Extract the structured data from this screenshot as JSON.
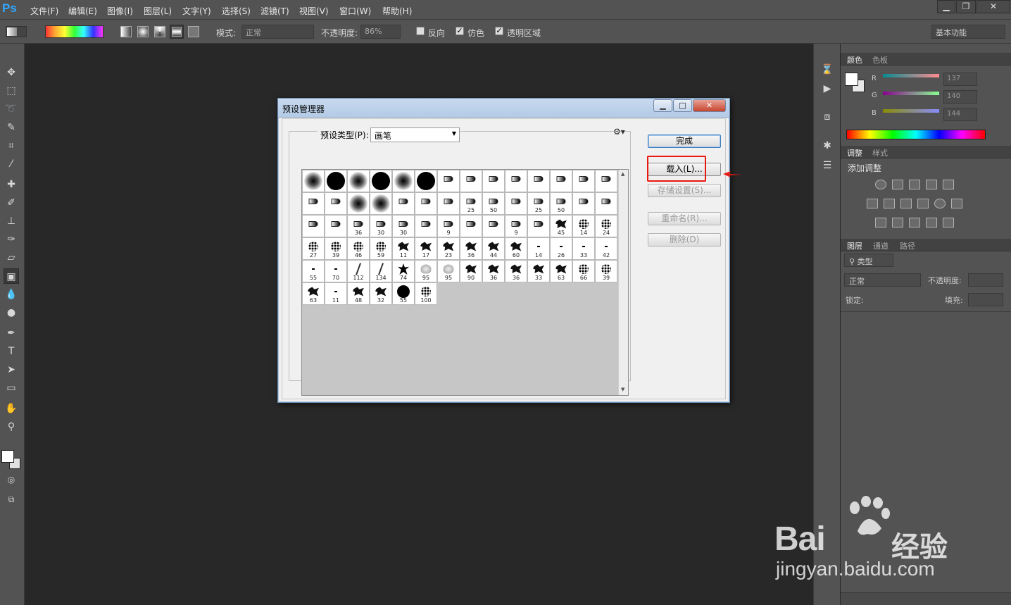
{
  "app": {
    "logo": "Ps"
  },
  "menu": [
    "文件(F)",
    "编辑(E)",
    "图像(I)",
    "图层(L)",
    "文字(Y)",
    "选择(S)",
    "滤镜(T)",
    "视图(V)",
    "窗口(W)",
    "帮助(H)"
  ],
  "window_buttons": [
    "minimize-icon",
    "restore-icon",
    "close-icon"
  ],
  "options": {
    "mode_label": "模式:",
    "mode_value": "正常",
    "opacity_label": "不透明度:",
    "opacity_value": "86%",
    "reverse_label": "反向",
    "reverse_checked": false,
    "dither_label": "仿色",
    "dither_checked": true,
    "transparency_label": "透明区域",
    "transparency_checked": true,
    "workspace": "基本功能"
  },
  "panels": {
    "color_tabs": [
      "颜色",
      "色板"
    ],
    "r_label": "R",
    "r_value": "137",
    "g_label": "G",
    "g_value": "140",
    "b_label": "B",
    "b_value": "144",
    "adjust_tabs": [
      "调整",
      "样式"
    ],
    "adjust_heading": "添加调整",
    "layers_tabs": [
      "图层",
      "通道",
      "路径"
    ],
    "filter_label": "类型",
    "blend_value": "正常",
    "layer_opacity_label": "不透明度:",
    "lock_label": "锁定:",
    "fill_label": "填充:"
  },
  "dialog": {
    "title": "预设管理器",
    "preset_type_label": "预设类型(P):",
    "preset_type_value": "画笔",
    "done_button": "完成",
    "load_button": "载入(L)...",
    "save_button": "存储设置(S)...",
    "rename_button": "重命名(R)...",
    "delete_button": "删除(D)",
    "brushes": [
      {
        "k": "soft",
        "s": ""
      },
      {
        "k": "hard",
        "s": ""
      },
      {
        "k": "soft",
        "s": ""
      },
      {
        "k": "hard",
        "s": ""
      },
      {
        "k": "soft",
        "s": ""
      },
      {
        "k": "hard",
        "s": ""
      },
      {
        "k": "tip",
        "s": ""
      },
      {
        "k": "tip",
        "s": ""
      },
      {
        "k": "tip",
        "s": ""
      },
      {
        "k": "tip",
        "s": ""
      },
      {
        "k": "tip",
        "s": ""
      },
      {
        "k": "tip",
        "s": ""
      },
      {
        "k": "tip",
        "s": ""
      },
      {
        "k": "tip",
        "s": ""
      },
      {
        "k": "tip",
        "s": ""
      },
      {
        "k": "tip",
        "s": ""
      },
      {
        "k": "soft",
        "s": ""
      },
      {
        "k": "soft",
        "s": ""
      },
      {
        "k": "tip",
        "s": ""
      },
      {
        "k": "tip",
        "s": ""
      },
      {
        "k": "tip",
        "s": ""
      },
      {
        "k": "tip",
        "s": "25"
      },
      {
        "k": "tip",
        "s": "50"
      },
      {
        "k": "tip",
        "s": ""
      },
      {
        "k": "tip",
        "s": "25"
      },
      {
        "k": "tip",
        "s": "50"
      },
      {
        "k": "tip",
        "s": ""
      },
      {
        "k": "tip",
        "s": ""
      },
      {
        "k": "tip",
        "s": ""
      },
      {
        "k": "tip",
        "s": ""
      },
      {
        "k": "tip",
        "s": "36"
      },
      {
        "k": "tip",
        "s": "30"
      },
      {
        "k": "tip",
        "s": "30"
      },
      {
        "k": "tip",
        "s": ""
      },
      {
        "k": "tip",
        "s": "9"
      },
      {
        "k": "tip",
        "s": ""
      },
      {
        "k": "tip",
        "s": ""
      },
      {
        "k": "tip",
        "s": "9"
      },
      {
        "k": "tip",
        "s": ""
      },
      {
        "k": "splat",
        "s": "45"
      },
      {
        "k": "scatter",
        "s": "14"
      },
      {
        "k": "scatter",
        "s": "24"
      },
      {
        "k": "scatter",
        "s": "27"
      },
      {
        "k": "scatter",
        "s": "39"
      },
      {
        "k": "scatter",
        "s": "46"
      },
      {
        "k": "scatter",
        "s": "59"
      },
      {
        "k": "splat",
        "s": "11"
      },
      {
        "k": "splat",
        "s": "17"
      },
      {
        "k": "splat",
        "s": "23"
      },
      {
        "k": "splat",
        "s": "36"
      },
      {
        "k": "splat",
        "s": "44"
      },
      {
        "k": "splat",
        "s": "60"
      },
      {
        "k": "dot",
        "s": "14"
      },
      {
        "k": "dot",
        "s": "26"
      },
      {
        "k": "dot",
        "s": "33"
      },
      {
        "k": "dot",
        "s": "42"
      },
      {
        "k": "dot",
        "s": "55"
      },
      {
        "k": "dot",
        "s": "70"
      },
      {
        "k": "grass",
        "s": "112"
      },
      {
        "k": "grass",
        "s": "134"
      },
      {
        "k": "leaf",
        "s": "74"
      },
      {
        "k": "gray",
        "s": "95"
      },
      {
        "k": "gray",
        "s": "95"
      },
      {
        "k": "splat",
        "s": "90"
      },
      {
        "k": "splat",
        "s": "36"
      },
      {
        "k": "splat",
        "s": "36"
      },
      {
        "k": "splat",
        "s": "33"
      },
      {
        "k": "splat",
        "s": "63"
      },
      {
        "k": "scatter",
        "s": "66"
      },
      {
        "k": "scatter",
        "s": "39"
      },
      {
        "k": "splat",
        "s": "63"
      },
      {
        "k": "dot",
        "s": "11"
      },
      {
        "k": "splat",
        "s": "48"
      },
      {
        "k": "splat",
        "s": "32"
      },
      {
        "k": "hard",
        "s": "55"
      },
      {
        "k": "scatter",
        "s": "100"
      }
    ]
  },
  "watermark": {
    "brand": "Bai",
    "brand_suffix": "经验",
    "url": "jingyan.baidu.com"
  }
}
